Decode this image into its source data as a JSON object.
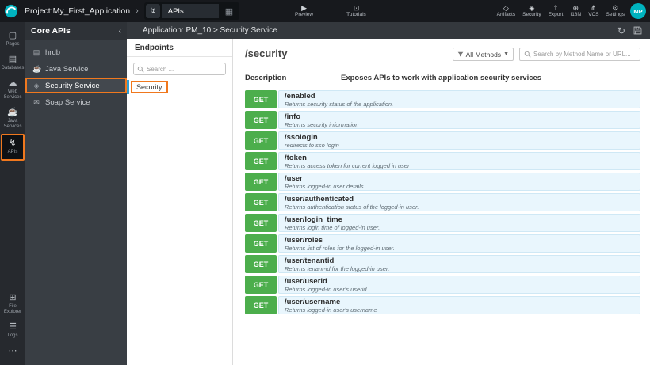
{
  "icons": {
    "chevron_right": "›",
    "plug": "↯",
    "grid": "▦",
    "preview": "▶",
    "tutorials": "⊡",
    "collapse": "‹",
    "caret_down": "▼",
    "refresh": "↻"
  },
  "top_bar": {
    "project_label": "Project:My_First_Application",
    "tab_label": "APIs",
    "preview_label": "Preview",
    "tutorials_label": "Tutorials",
    "tools": [
      {
        "label": "Artifacts",
        "icon": "artifacts-icon",
        "glyph": "◇"
      },
      {
        "label": "Security",
        "icon": "security-icon",
        "glyph": "◈"
      },
      {
        "label": "Export",
        "icon": "export-icon",
        "glyph": "↥"
      },
      {
        "label": "I18N",
        "icon": "i18n-icon",
        "glyph": "⊕"
      },
      {
        "label": "VCS",
        "icon": "vcs-icon",
        "glyph": "⋔"
      },
      {
        "label": "Settings",
        "icon": "settings-icon",
        "glyph": "⚙"
      }
    ],
    "avatar_initials": "MP"
  },
  "left_rail": {
    "items": [
      {
        "label": "Pages",
        "icon": "pages-icon",
        "glyph": "▢"
      },
      {
        "label": "Databases",
        "icon": "databases-icon",
        "glyph": "▤"
      },
      {
        "label": "Web Services",
        "icon": "web-services-icon",
        "glyph": "☁"
      },
      {
        "label": "Java Services",
        "icon": "java-services-icon",
        "glyph": "☕"
      },
      {
        "label": "APIs",
        "icon": "apis-icon",
        "glyph": "↯",
        "active": true
      }
    ],
    "bottom_items": [
      {
        "label": "File Explorer",
        "icon": "file-explorer-icon",
        "glyph": "⊞"
      },
      {
        "label": "Logs",
        "icon": "logs-icon",
        "glyph": "☰"
      },
      {
        "label": "",
        "icon": "more-icon",
        "glyph": "⋯"
      }
    ]
  },
  "api_panel": {
    "title": "Core APIs",
    "items": [
      {
        "label": "hrdb",
        "icon": "database-icon",
        "glyph": "▤"
      },
      {
        "label": "Java Service",
        "icon": "java-icon",
        "glyph": "☕"
      },
      {
        "label": "Security Service",
        "icon": "shield-icon",
        "glyph": "◈",
        "active": true
      },
      {
        "label": "Soap Service",
        "icon": "envelope-icon",
        "glyph": "✉"
      }
    ]
  },
  "endpoints_panel": {
    "title": "Endpoints",
    "search_placeholder": "Search ...",
    "items": [
      {
        "label": "Security",
        "active": true
      }
    ]
  },
  "content": {
    "breadcrumb": "Application: PM_10 > Security Service",
    "service_path": "/security",
    "methods_filter_label": "All Methods",
    "search_placeholder": "Search by Method Name or URL...",
    "description_label": "Description",
    "description_text": "Exposes APIs to work with application security services",
    "endpoints": [
      {
        "method": "GET",
        "path": "/enabled",
        "description": "Returns security status of the application."
      },
      {
        "method": "GET",
        "path": "/info",
        "description": "Returns security information"
      },
      {
        "method": "GET",
        "path": "/ssologin",
        "description": "redirects to sso login"
      },
      {
        "method": "GET",
        "path": "/token",
        "description": "Returns access token for current logged in user"
      },
      {
        "method": "GET",
        "path": "/user",
        "description": "Returns logged-in user details."
      },
      {
        "method": "GET",
        "path": "/user/authenticated",
        "description": "Returns authentication status of the logged-in user."
      },
      {
        "method": "GET",
        "path": "/user/login_time",
        "description": "Returns login time of logged-in user."
      },
      {
        "method": "GET",
        "path": "/user/roles",
        "description": "Returns list of roles for the logged-in user."
      },
      {
        "method": "GET",
        "path": "/user/tenantid",
        "description": "Returns tenant-id for the logged-in user."
      },
      {
        "method": "GET",
        "path": "/user/userid",
        "description": "Returns logged-in user's userid"
      },
      {
        "method": "GET",
        "path": "/user/username",
        "description": "Returns logged-in user's username"
      }
    ]
  },
  "colors": {
    "accent_orange": "#f0781e",
    "method_get_green": "#4cae4c",
    "row_background_blue": "#e9f6fd",
    "brand_teal": "#00b3bf"
  }
}
